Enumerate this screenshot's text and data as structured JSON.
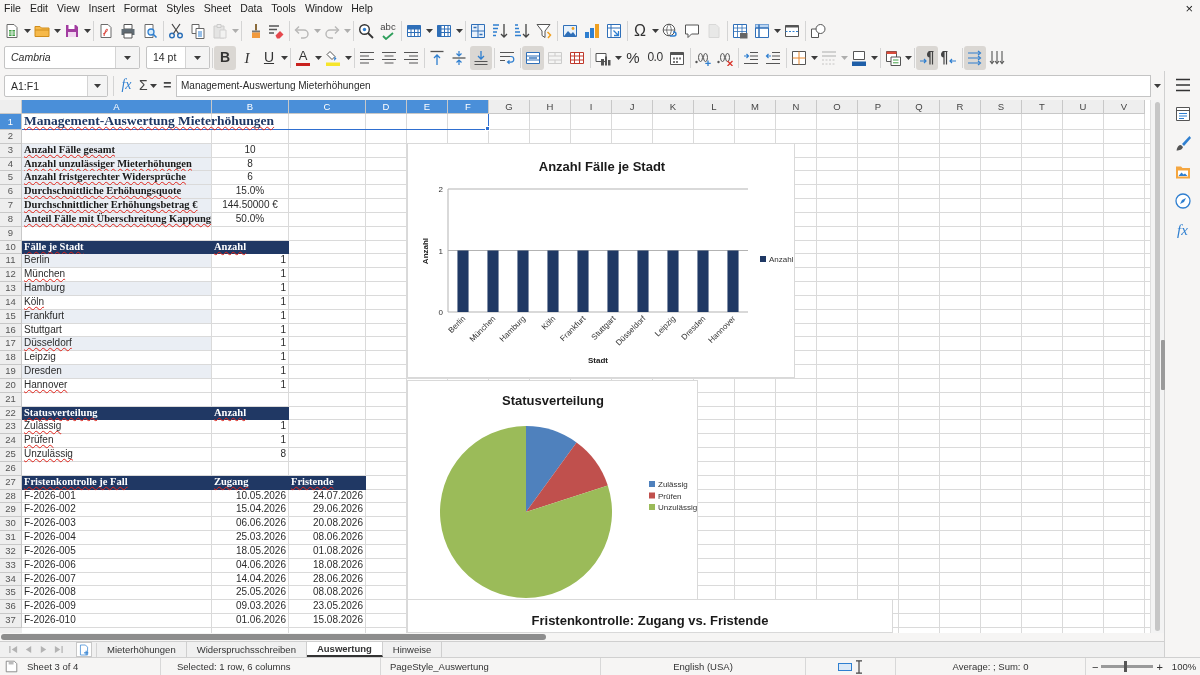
{
  "menu": [
    "File",
    "Edit",
    "View",
    "Insert",
    "Format",
    "Styles",
    "Sheet",
    "Data",
    "Tools",
    "Window",
    "Help"
  ],
  "close_button": "×",
  "standard_toolbar": [
    {
      "disabled": false
    },
    {
      "disabled": false
    },
    {
      "disabled": false
    },
    {
      "disabled": false
    },
    {
      "disabled": false
    },
    {
      "disabled": false
    },
    {
      "disabled": false
    },
    {
      "disabled": false
    },
    {
      "disabled": true
    },
    {
      "disabled": false
    },
    {
      "disabled": false
    },
    {
      "disabled": true
    },
    {
      "disabled": true
    },
    {
      "disabled": false
    },
    {
      "label": "abc",
      "disabled": false
    },
    {
      "disabled": false
    },
    {
      "disabled": false
    },
    {
      "disabled": false
    },
    {
      "disabled": false
    },
    {
      "disabled": false
    },
    {
      "disabled": false
    },
    {
      "disabled": false
    },
    {
      "disabled": false
    },
    {
      "disabled": false
    },
    {
      "label": "Ω",
      "disabled": false
    },
    {
      "disabled": false
    },
    {
      "disabled": false
    },
    {
      "disabled": true
    },
    {
      "disabled": false
    },
    {
      "disabled": false
    },
    {
      "disabled": false
    },
    {
      "disabled": false
    }
  ],
  "formatting_toolbar": {
    "font_name": "Cambria",
    "font_size": "14 pt",
    "buttons": [
      {
        "label": "B",
        "on": true,
        "disabled": false
      },
      {
        "label": "I",
        "on": false,
        "disabled": false
      },
      {
        "label": "U",
        "on": false,
        "disabled": false
      },
      {
        "label": "A",
        "on": false,
        "disabled": false
      },
      {
        "on": false,
        "disabled": false
      },
      {
        "on": false,
        "disabled": false
      },
      {
        "on": false,
        "disabled": false
      },
      {
        "on": false,
        "disabled": false
      },
      {
        "on": false,
        "disabled": false
      },
      {
        "on": false,
        "disabled": false
      },
      {
        "on": true,
        "disabled": false
      },
      {
        "on": false,
        "disabled": false
      },
      {
        "on": true,
        "disabled": false
      },
      {
        "on": false,
        "disabled": true
      },
      {
        "on": false,
        "disabled": false
      },
      {
        "on": false,
        "disabled": false
      },
      {
        "label": "%",
        "on": false,
        "disabled": false
      },
      {
        "label": "0.0",
        "on": false,
        "disabled": false
      },
      {
        "on": false,
        "disabled": false
      },
      {
        "on": false,
        "disabled": false
      },
      {
        "on": false,
        "disabled": false
      },
      {
        "on": false,
        "disabled": false
      },
      {
        "on": false,
        "disabled": false
      },
      {
        "on": false,
        "disabled": false
      },
      {
        "on": false,
        "disabled": true
      },
      {
        "on": false,
        "disabled": false
      },
      {
        "on": false,
        "disabled": false
      },
      {
        "on": true,
        "disabled": false
      },
      {
        "on": false,
        "disabled": false
      },
      {
        "on": true,
        "disabled": false
      },
      {
        "on": false,
        "disabled": false
      }
    ]
  },
  "formula_bar": {
    "name_box": "A1:F1",
    "function_wizard": "fx",
    "sum": "Σ",
    "equals": "=",
    "content": "Management-Auswertung Mieterhöhungen"
  },
  "sidebar": {
    "functions": "fx"
  },
  "sheet": {
    "columns": [
      {
        "letter": "A",
        "selected": true
      },
      {
        "letter": "B",
        "selected": true
      },
      {
        "letter": "C",
        "selected": true
      },
      {
        "letter": "D",
        "selected": true
      },
      {
        "letter": "E",
        "selected": true
      },
      {
        "letter": "F",
        "selected": true
      },
      {
        "letter": "G",
        "selected": false
      },
      {
        "letter": "H",
        "selected": false
      },
      {
        "letter": "I",
        "selected": false
      },
      {
        "letter": "J",
        "selected": false
      },
      {
        "letter": "K",
        "selected": false
      },
      {
        "letter": "L",
        "selected": false
      },
      {
        "letter": "M",
        "selected": false
      },
      {
        "letter": "N",
        "selected": false
      },
      {
        "letter": "O",
        "selected": false
      },
      {
        "letter": "P",
        "selected": false
      },
      {
        "letter": "Q",
        "selected": false
      },
      {
        "letter": "R",
        "selected": false
      },
      {
        "letter": "S",
        "selected": false
      },
      {
        "letter": "T",
        "selected": false
      },
      {
        "letter": "U",
        "selected": false
      },
      {
        "letter": "V",
        "selected": false
      }
    ],
    "rows": [
      {
        "number": "1",
        "selected": true,
        "kind": "title",
        "cells": [
          {
            "text": "Management-Auswertung Mieterhöhungen",
            "misspelled": true
          }
        ]
      },
      {
        "number": "2",
        "selected": false,
        "kind": "blank"
      },
      {
        "number": "3",
        "selected": false,
        "kind": "kpi",
        "shaded": true,
        "cells": [
          {
            "text": "Anzahl Fälle gesamt",
            "misspelled": true
          },
          {
            "text": "10",
            "misspelled": false
          }
        ]
      },
      {
        "number": "4",
        "selected": false,
        "kind": "kpi",
        "shaded": true,
        "cells": [
          {
            "text": "Anzahl unzulässiger Mieterhöhungen",
            "misspelled": true
          },
          {
            "text": "8",
            "misspelled": false
          }
        ]
      },
      {
        "number": "5",
        "selected": false,
        "kind": "kpi",
        "shaded": true,
        "cells": [
          {
            "text": "Anzahl fristgerechter Widersprüche",
            "misspelled": true
          },
          {
            "text": "6",
            "misspelled": false
          }
        ]
      },
      {
        "number": "6",
        "selected": false,
        "kind": "kpi",
        "shaded": true,
        "cells": [
          {
            "text": "Durchschnittliche Erhöhungsquote",
            "misspelled": true
          },
          {
            "text": "15.0%",
            "misspelled": false
          }
        ]
      },
      {
        "number": "7",
        "selected": false,
        "kind": "kpi",
        "shaded": true,
        "cells": [
          {
            "text": "Durchschnittlicher Erhöhungsbetrag €",
            "misspelled": true
          },
          {
            "text": "144.50000 €",
            "misspelled": false
          }
        ]
      },
      {
        "number": "8",
        "selected": false,
        "kind": "kpi",
        "shaded": true,
        "cells": [
          {
            "text": "Anteil Fälle mit Überschreitung Kappung",
            "misspelled": true
          },
          {
            "text": "50.0%",
            "misspelled": false
          }
        ]
      },
      {
        "number": "9",
        "selected": false,
        "kind": "blank"
      },
      {
        "number": "10",
        "selected": false,
        "kind": "header",
        "cells": [
          {
            "text": "Fälle je Stadt",
            "misspelled": true
          },
          {
            "text": "Anzahl",
            "misspelled": true
          }
        ]
      },
      {
        "number": "11",
        "selected": false,
        "kind": "data",
        "shaded": true,
        "cells": [
          {
            "text": "Berlin",
            "misspelled": false
          },
          {
            "text": "1",
            "misspelled": false
          }
        ]
      },
      {
        "number": "12",
        "selected": false,
        "kind": "data",
        "shaded": false,
        "cells": [
          {
            "text": "München",
            "misspelled": true
          },
          {
            "text": "1",
            "misspelled": false
          }
        ]
      },
      {
        "number": "13",
        "selected": false,
        "kind": "data",
        "shaded": true,
        "cells": [
          {
            "text": "Hamburg",
            "misspelled": false
          },
          {
            "text": "1",
            "misspelled": false
          }
        ]
      },
      {
        "number": "14",
        "selected": false,
        "kind": "data",
        "shaded": false,
        "cells": [
          {
            "text": "Köln",
            "misspelled": true
          },
          {
            "text": "1",
            "misspelled": false
          }
        ]
      },
      {
        "number": "15",
        "selected": false,
        "kind": "data",
        "shaded": true,
        "cells": [
          {
            "text": "Frankfurt",
            "misspelled": false
          },
          {
            "text": "1",
            "misspelled": false
          }
        ]
      },
      {
        "number": "16",
        "selected": false,
        "kind": "data",
        "shaded": false,
        "cells": [
          {
            "text": "Stuttgart",
            "misspelled": false
          },
          {
            "text": "1",
            "misspelled": false
          }
        ]
      },
      {
        "number": "17",
        "selected": false,
        "kind": "data",
        "shaded": true,
        "cells": [
          {
            "text": "Düsseldorf",
            "misspelled": true
          },
          {
            "text": "1",
            "misspelled": false
          }
        ]
      },
      {
        "number": "18",
        "selected": false,
        "kind": "data",
        "shaded": false,
        "cells": [
          {
            "text": "Leipzig",
            "misspelled": false
          },
          {
            "text": "1",
            "misspelled": false
          }
        ]
      },
      {
        "number": "19",
        "selected": false,
        "kind": "data",
        "shaded": true,
        "cells": [
          {
            "text": "Dresden",
            "misspelled": false
          },
          {
            "text": "1",
            "misspelled": false
          }
        ]
      },
      {
        "number": "20",
        "selected": false,
        "kind": "data",
        "shaded": false,
        "cells": [
          {
            "text": "Hannover",
            "misspelled": true
          },
          {
            "text": "1",
            "misspelled": false
          }
        ]
      },
      {
        "number": "21",
        "selected": false,
        "kind": "blank"
      },
      {
        "number": "22",
        "selected": false,
        "kind": "header",
        "cells": [
          {
            "text": "Statusverteilung",
            "misspelled": true
          },
          {
            "text": "Anzahl",
            "misspelled": true
          }
        ]
      },
      {
        "number": "23",
        "selected": false,
        "kind": "data",
        "shaded": false,
        "cells": [
          {
            "text": "Zulässig",
            "misspelled": true
          },
          {
            "text": "1",
            "misspelled": false
          }
        ]
      },
      {
        "number": "24",
        "selected": false,
        "kind": "data",
        "shaded": false,
        "cells": [
          {
            "text": "Prüfen",
            "misspelled": true
          },
          {
            "text": "1",
            "misspelled": false
          }
        ]
      },
      {
        "number": "25",
        "selected": false,
        "kind": "data",
        "shaded": false,
        "cells": [
          {
            "text": "Unzulässig",
            "misspelled": true
          },
          {
            "text": "8",
            "misspelled": false
          }
        ]
      },
      {
        "number": "26",
        "selected": false,
        "kind": "blank"
      },
      {
        "number": "27",
        "selected": false,
        "kind": "header",
        "cells": [
          {
            "text": "Fristenkontrolle je Fall",
            "misspelled": true
          },
          {
            "text": "Zugang",
            "misspelled": true
          },
          {
            "text": "Fristende",
            "misspelled": true
          }
        ]
      },
      {
        "number": "28",
        "selected": false,
        "kind": "data",
        "shaded": false,
        "cells": [
          {
            "text": "F-2026-001",
            "misspelled": false
          },
          {
            "text": "10.05.2026",
            "misspelled": false
          },
          {
            "text": "24.07.2026",
            "misspelled": false
          }
        ]
      },
      {
        "number": "29",
        "selected": false,
        "kind": "data",
        "shaded": false,
        "cells": [
          {
            "text": "F-2026-002",
            "misspelled": false
          },
          {
            "text": "15.04.2026",
            "misspelled": false
          },
          {
            "text": "29.06.2026",
            "misspelled": false
          }
        ]
      },
      {
        "number": "30",
        "selected": false,
        "kind": "data",
        "shaded": false,
        "cells": [
          {
            "text": "F-2026-003",
            "misspelled": false
          },
          {
            "text": "06.06.2026",
            "misspelled": false
          },
          {
            "text": "20.08.2026",
            "misspelled": false
          }
        ]
      },
      {
        "number": "31",
        "selected": false,
        "kind": "data",
        "shaded": false,
        "cells": [
          {
            "text": "F-2026-004",
            "misspelled": false
          },
          {
            "text": "25.03.2026",
            "misspelled": false
          },
          {
            "text": "08.06.2026",
            "misspelled": false
          }
        ]
      },
      {
        "number": "32",
        "selected": false,
        "kind": "data",
        "shaded": false,
        "cells": [
          {
            "text": "F-2026-005",
            "misspelled": false
          },
          {
            "text": "18.05.2026",
            "misspelled": false
          },
          {
            "text": "01.08.2026",
            "misspelled": false
          }
        ]
      },
      {
        "number": "33",
        "selected": false,
        "kind": "data",
        "shaded": false,
        "cells": [
          {
            "text": "F-2026-006",
            "misspelled": false
          },
          {
            "text": "04.06.2026",
            "misspelled": false
          },
          {
            "text": "18.08.2026",
            "misspelled": false
          }
        ]
      },
      {
        "number": "34",
        "selected": false,
        "kind": "data",
        "shaded": false,
        "cells": [
          {
            "text": "F-2026-007",
            "misspelled": false
          },
          {
            "text": "14.04.2026",
            "misspelled": false
          },
          {
            "text": "28.06.2026",
            "misspelled": false
          }
        ]
      },
      {
        "number": "35",
        "selected": false,
        "kind": "data",
        "shaded": false,
        "cells": [
          {
            "text": "F-2026-008",
            "misspelled": false
          },
          {
            "text": "25.05.2026",
            "misspelled": false
          },
          {
            "text": "08.08.2026",
            "misspelled": false
          }
        ]
      },
      {
        "number": "36",
        "selected": false,
        "kind": "data",
        "shaded": false,
        "cells": [
          {
            "text": "F-2026-009",
            "misspelled": false
          },
          {
            "text": "09.03.2026",
            "misspelled": false
          },
          {
            "text": "23.05.2026",
            "misspelled": false
          }
        ]
      },
      {
        "number": "37",
        "selected": false,
        "kind": "data",
        "shaded": false,
        "cells": [
          {
            "text": "F-2026-010",
            "misspelled": false
          },
          {
            "text": "01.06.2026",
            "misspelled": false
          },
          {
            "text": "15.08.2026",
            "misspelled": false
          }
        ]
      }
    ]
  },
  "charts": [
    {
      "chart_data": {
        "type": "bar",
        "title": "Anzahl Fälle je Stadt",
        "xlabel": "Stadt",
        "ylabel": "Anzahl",
        "categories": [
          "Berlin",
          "München",
          "Hamburg",
          "Köln",
          "Frankfurt",
          "Stuttgart",
          "Düsseldorf",
          "Leipzig",
          "Dresden",
          "Hannover"
        ],
        "series": [
          {
            "name": "Anzahl",
            "color": "#1f3864",
            "values": [
              1,
              1,
              1,
              1,
              1,
              1,
              1,
              1,
              1,
              1
            ]
          }
        ],
        "ylim": [
          0,
          2
        ],
        "yticks": [
          0,
          1,
          2
        ],
        "legend": "right"
      }
    },
    {
      "chart_data": {
        "type": "pie",
        "title": "Statusverteilung",
        "categories": [
          "Zulässig",
          "Prüfen",
          "Unzulässig"
        ],
        "series": [
          {
            "values": [
              10,
              10,
              80
            ],
            "colors": [
              "#4f81bd",
              "#c0504d",
              "#9bbb59"
            ]
          }
        ],
        "legend": "right"
      }
    },
    {
      "title": "Fristenkontrolle: Zugang vs. Fristende"
    }
  ],
  "sheet_tabs": {
    "navigation": [
      {
        "disabled": true
      },
      {
        "disabled": true
      },
      {
        "disabled": true
      },
      {
        "disabled": true
      }
    ],
    "tabs": [
      {
        "label": "Mieterhöhungen",
        "selected": false
      },
      {
        "label": "Widerspruchsschreiben",
        "selected": false
      },
      {
        "label": "Auswertung",
        "selected": true
      },
      {
        "label": "Hinweise",
        "selected": false
      }
    ]
  },
  "status_bar": {
    "sheet_info": "Sheet 3 of 4",
    "selection": "Selected: 1 row, 6 columns",
    "page_style": "PageStyle_Auswertung",
    "language": "English (USA)",
    "summary": "Average: ; Sum: 0",
    "zoom_out": "−",
    "zoom_slider": {
      "level": 0.45
    },
    "zoom_in": "+",
    "zoom": "100%"
  }
}
